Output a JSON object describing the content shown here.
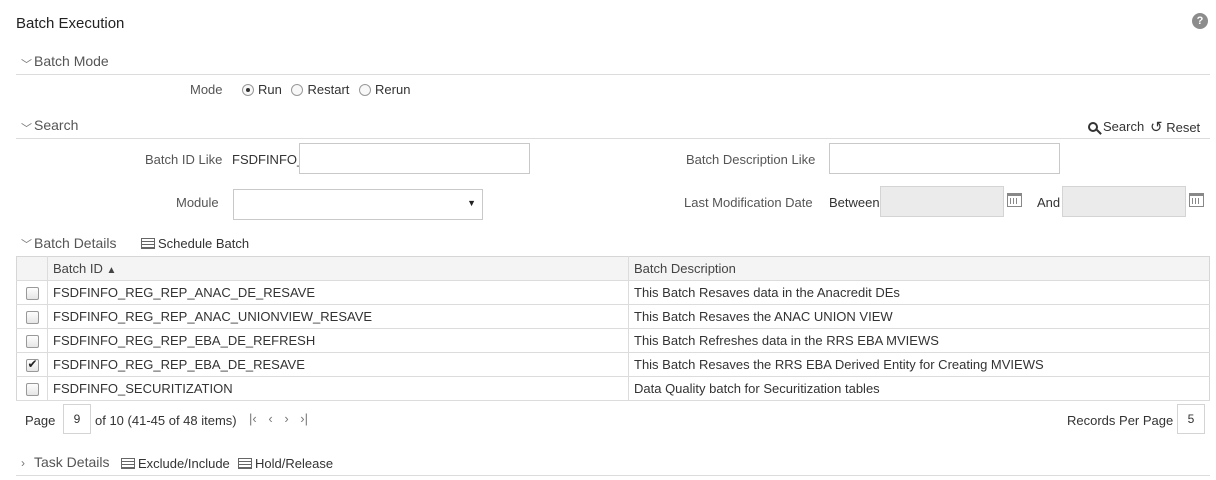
{
  "page": {
    "title": "Batch Execution",
    "help": "?"
  },
  "batch_mode": {
    "header": "Batch Mode",
    "mode_label": "Mode",
    "options": [
      "Run",
      "Restart",
      "Rerun"
    ],
    "selected": "Run"
  },
  "search": {
    "header": "Search",
    "search_btn": "Search",
    "reset_btn": "Reset",
    "batch_id_label": "Batch ID Like",
    "batch_id_prefix": "FSDFINFO_",
    "batch_id_value": "",
    "batch_desc_label": "Batch Description Like",
    "batch_desc_value": "",
    "module_label": "Module",
    "module_value": "",
    "last_mod_label": "Last Modification Date",
    "between_label": "Between",
    "and_label": "And"
  },
  "batch_details": {
    "header": "Batch Details",
    "schedule_btn": "Schedule Batch",
    "columns": [
      "Batch ID",
      "Batch Description"
    ],
    "sort_indicator": "▲",
    "rows": [
      {
        "id": "FSDFINFO_REG_REP_ANAC_DE_RESAVE",
        "desc": "This Batch Resaves data in the Anacredit DEs",
        "checked": false
      },
      {
        "id": "FSDFINFO_REG_REP_ANAC_UNIONVIEW_RESAVE",
        "desc": "This Batch Resaves the ANAC UNION VIEW",
        "checked": false
      },
      {
        "id": "FSDFINFO_REG_REP_EBA_DE_REFRESH",
        "desc": "This Batch Refreshes data in the RRS EBA MVIEWS",
        "checked": false
      },
      {
        "id": "FSDFINFO_REG_REP_EBA_DE_RESAVE",
        "desc": "This Batch Resaves the RRS EBA Derived Entity for Creating MVIEWS",
        "checked": true
      },
      {
        "id": "FSDFINFO_SECURITIZATION",
        "desc": "Data Quality batch for Securitization tables",
        "checked": false
      }
    ]
  },
  "pager": {
    "page_label": "Page",
    "page_value": "9",
    "page_info": "of 10 (41-45 of 48 items)",
    "first": "K",
    "prev": "‹",
    "next": "›",
    "last": "›|",
    "records_label": "Records Per Page",
    "records_value": "5"
  },
  "task_details": {
    "header": "Task Details",
    "exclude_btn": "Exclude/Include",
    "hold_btn": "Hold/Release"
  }
}
